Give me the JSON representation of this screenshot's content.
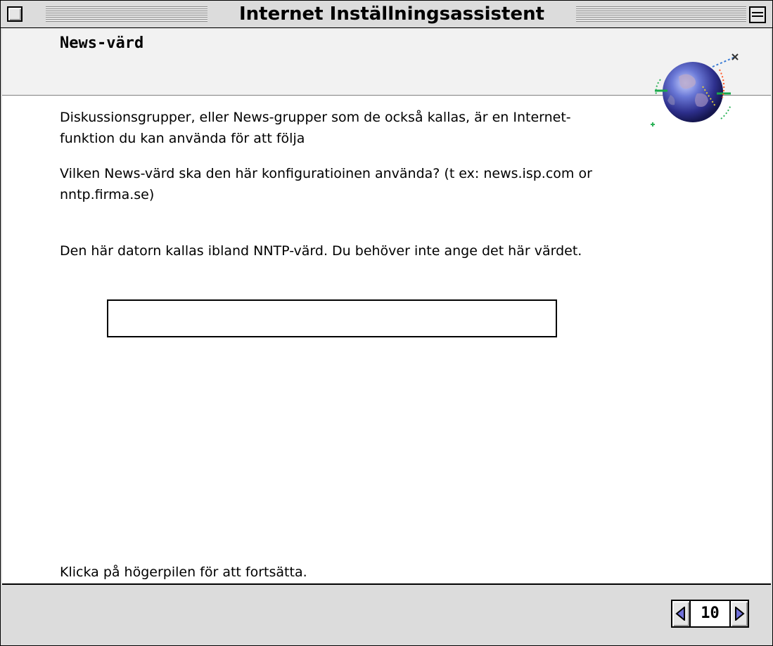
{
  "window": {
    "title": "Internet Inställningsassistent"
  },
  "header": {
    "title": "News-värd",
    "icon": "globe-icon"
  },
  "content": {
    "intro": "Diskussionsgrupper, eller News-grupper som de också kallas, är en Internet-funktion du kan använda för att följa",
    "question": "Vilken News-värd ska den här konfiguratioinen använda? (t ex: news.isp.com or nntp.firma.se)",
    "note": "Den här datorn kallas ibland NNTP-värd. Du behöver inte ange det här värdet.",
    "news_host_value": "",
    "instruction": "Klicka på högerpilen för att fortsätta."
  },
  "footer": {
    "page_number": "10",
    "prev_icon": "left-arrow-icon",
    "next_icon": "right-arrow-icon"
  }
}
